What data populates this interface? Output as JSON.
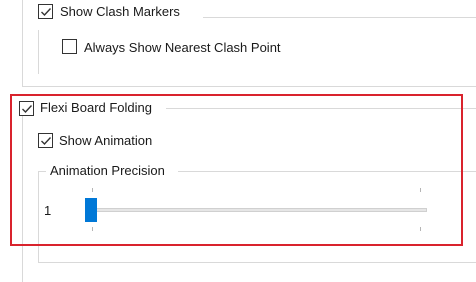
{
  "clash_group": {
    "show_clash_markers": {
      "label": "Show Clash Markers",
      "checked": true
    },
    "always_show_nearest": {
      "label": "Always Show Nearest Clash Point",
      "checked": false
    }
  },
  "flexi_group": {
    "flexi_board_folding": {
      "label": "Flexi Board Folding",
      "checked": true
    },
    "show_animation": {
      "label": "Show Animation",
      "checked": true
    },
    "animation_precision": {
      "title": "Animation Precision",
      "value": "1",
      "slider_level": 0
    }
  },
  "colors": {
    "highlight": "#d9232d",
    "slider_thumb": "#0078d7"
  }
}
